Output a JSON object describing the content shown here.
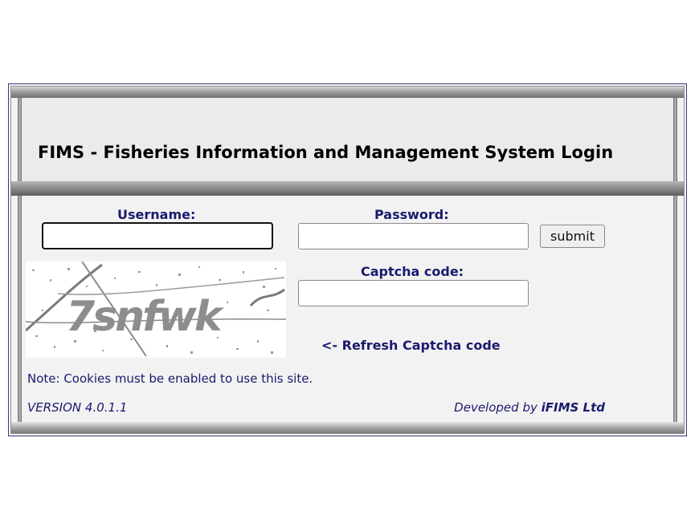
{
  "header": {
    "title": "FIMS - Fisheries Information and Management System Login"
  },
  "form": {
    "username_label": "Username:",
    "username_value": "",
    "password_label": "Password:",
    "password_value": "",
    "submit_label": "submit",
    "captcha_label": "Captcha code:",
    "captcha_value": "",
    "captcha_image_text": "7snfwk",
    "refresh_label": "<- Refresh Captcha code"
  },
  "footer": {
    "note": "Note: Cookies must be enabled to use this site.",
    "version": "VERSION 4.0.1.1",
    "developed_by_prefix": "Developed by ",
    "developer": "iFIMS Ltd"
  },
  "colors": {
    "label_color": "#1a1a6e",
    "border_color": "#3a3a7a",
    "panel_bg": "#f2f2f2",
    "header_bg": "#ebebeb"
  }
}
